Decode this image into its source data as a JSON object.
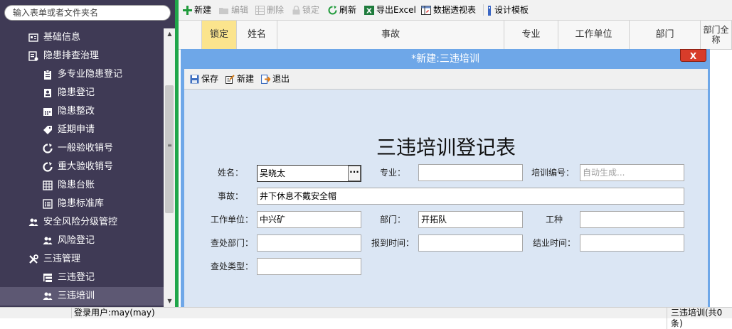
{
  "sidebar": {
    "search_placeholder": "输入表单或者文件夹名",
    "items": [
      {
        "label": "基础信息",
        "icon": "id-card-icon",
        "level": 1
      },
      {
        "label": "隐患排查治理",
        "icon": "settings-list-icon",
        "level": 1
      },
      {
        "label": "多专业隐患登记",
        "icon": "clipboard-icon",
        "level": 2
      },
      {
        "label": "隐患登记",
        "icon": "contact-book-icon",
        "level": 2
      },
      {
        "label": "隐患整改",
        "icon": "calendar-icon",
        "level": 2
      },
      {
        "label": "延期申请",
        "icon": "tag-icon",
        "level": 2
      },
      {
        "label": "一般验收销号",
        "icon": "refresh-icon",
        "level": 2
      },
      {
        "label": "重大验收销号",
        "icon": "refresh-icon",
        "level": 2
      },
      {
        "label": "隐患台账",
        "icon": "table-icon",
        "level": 2
      },
      {
        "label": "隐患标准库",
        "icon": "list-icon",
        "level": 2
      },
      {
        "label": "安全风险分级管控",
        "icon": "users-icon",
        "level": 1
      },
      {
        "label": "风险登记",
        "icon": "users-icon",
        "level": 2
      },
      {
        "label": "三违管理",
        "icon": "tools-icon",
        "level": 1
      },
      {
        "label": "三违登记",
        "icon": "tree-list-icon",
        "level": 2
      },
      {
        "label": "三违培训",
        "icon": "users-icon",
        "level": 2,
        "selected": true
      }
    ]
  },
  "toolbar": {
    "new": "新建",
    "edit": "编辑",
    "delete": "删除",
    "lock": "锁定",
    "refresh": "刷新",
    "export_excel": "导出Excel",
    "pivot": "数据透视表",
    "design_template": "设计模板"
  },
  "grid": {
    "columns": [
      "锁定",
      "姓名",
      "事故",
      "专业",
      "工作单位",
      "部门",
      "部门全称"
    ]
  },
  "modal": {
    "title": "*新建:三违培训",
    "close": "X",
    "toolbar": {
      "save": "保存",
      "new": "新建",
      "exit": "退出"
    },
    "form_title": "三违培训登记表",
    "labels": {
      "name": "姓名：",
      "specialty": "专业：",
      "training_no": "培训编号：",
      "incident": "事故：",
      "work_unit": "工作单位：",
      "department": "部门：",
      "job_type": "工种",
      "dept_check": "查处部门：",
      "report_time": "报到时间：",
      "end_time": "结业时间：",
      "check_type": "查处类型："
    },
    "values": {
      "name": "吴晓太",
      "name_button": "···",
      "specialty": "",
      "training_no_placeholder": "自动生成...",
      "incident": "井下休息不戴安全帽",
      "work_unit": "中兴矿",
      "department": "开拓队",
      "job_type": "",
      "dept_check": "",
      "report_time": "",
      "end_time": "",
      "check_type": ""
    }
  },
  "status": {
    "user": "登录用户:may(may)",
    "count": "三违培训(共0条)"
  }
}
